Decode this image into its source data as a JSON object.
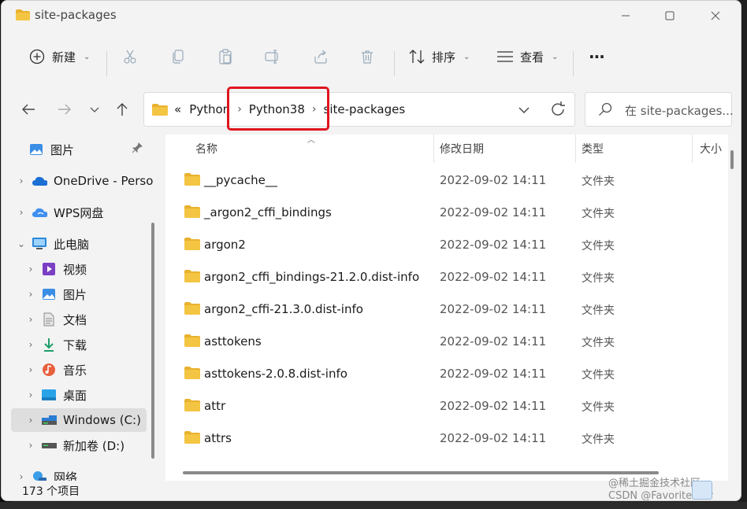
{
  "window": {
    "title": "site-packages"
  },
  "toolbar": {
    "new_label": "新建",
    "sort_label": "排序",
    "view_label": "查看",
    "more_label": "···"
  },
  "address": {
    "overflow": "«",
    "crumbs": [
      "Python",
      "Python38",
      "site-packages"
    ],
    "search_placeholder": "在 site-packages..."
  },
  "sidebar": {
    "items": [
      {
        "label": "图片",
        "icon": "pictures-icon",
        "pinned": true
      },
      {
        "label": "OneDrive - Perso",
        "icon": "onedrive-icon"
      },
      {
        "label": "WPS网盘",
        "icon": "wps-cloud-icon"
      },
      {
        "label": "此电脑",
        "icon": "computer-icon",
        "expanded": true
      },
      {
        "label": "视频",
        "icon": "videos-icon"
      },
      {
        "label": "图片",
        "icon": "pictures-icon"
      },
      {
        "label": "文档",
        "icon": "documents-icon"
      },
      {
        "label": "下载",
        "icon": "downloads-icon"
      },
      {
        "label": "音乐",
        "icon": "music-icon"
      },
      {
        "label": "桌面",
        "icon": "desktop-icon"
      },
      {
        "label": "Windows (C:)",
        "icon": "drive-c-icon",
        "selected": true
      },
      {
        "label": "新加卷 (D:)",
        "icon": "drive-d-icon"
      },
      {
        "label": "网络",
        "icon": "network-icon"
      }
    ]
  },
  "columns": {
    "name": "名称",
    "modified": "修改日期",
    "type": "类型",
    "size": "大小"
  },
  "files": [
    {
      "name": "__pycache__",
      "modified": "2022-09-02 14:11",
      "type": "文件夹"
    },
    {
      "name": "_argon2_cffi_bindings",
      "modified": "2022-09-02 14:11",
      "type": "文件夹"
    },
    {
      "name": "argon2",
      "modified": "2022-09-02 14:11",
      "type": "文件夹"
    },
    {
      "name": "argon2_cffi_bindings-21.2.0.dist-info",
      "modified": "2022-09-02 14:11",
      "type": "文件夹"
    },
    {
      "name": "argon2_cffi-21.3.0.dist-info",
      "modified": "2022-09-02 14:11",
      "type": "文件夹"
    },
    {
      "name": "asttokens",
      "modified": "2022-09-02 14:11",
      "type": "文件夹"
    },
    {
      "name": "asttokens-2.0.8.dist-info",
      "modified": "2022-09-02 14:11",
      "type": "文件夹"
    },
    {
      "name": "attr",
      "modified": "2022-09-02 14:11",
      "type": "文件夹"
    },
    {
      "name": "attrs",
      "modified": "2022-09-02 14:11",
      "type": "文件夹"
    }
  ],
  "status": {
    "count": "173 个项目"
  },
  "watermark": {
    "line1": "@稀土掘金技术社区",
    "line2": "CSDN @FavoriteStar"
  },
  "colors": {
    "folder": "#f4c542",
    "highlight_box": "#e0141e",
    "window_bg": "#f3f3f3"
  }
}
